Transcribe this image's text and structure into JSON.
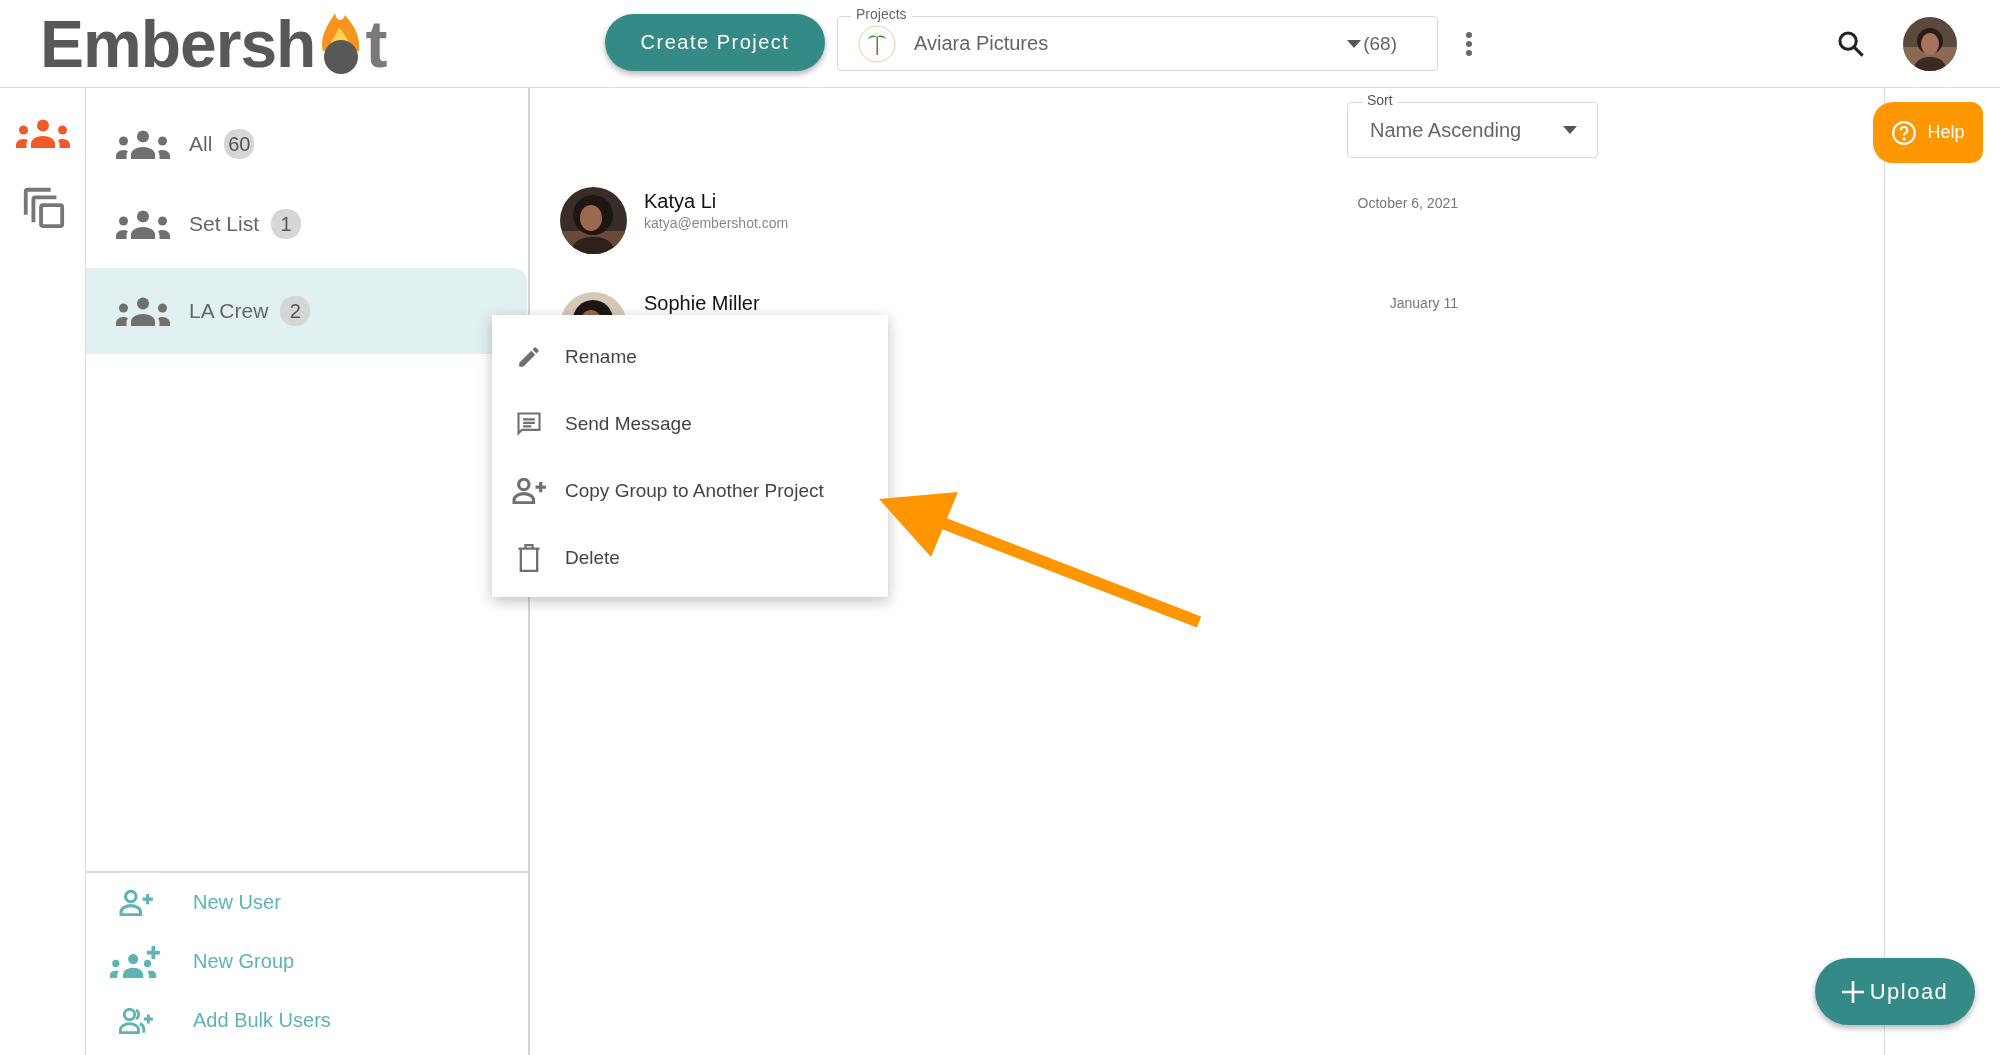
{
  "header": {
    "logo": {
      "before": "Embersh",
      "after": "t"
    },
    "create_button": "Create Project",
    "project_field": {
      "label": "Projects",
      "value": "Aviara Pictures",
      "count": "(68)"
    }
  },
  "rail": [
    {
      "kind": "groups",
      "selected": true
    },
    {
      "kind": "copy",
      "selected": false
    }
  ],
  "groups": [
    {
      "name": "All",
      "count": "60",
      "selected": false
    },
    {
      "name": "Set List",
      "count": "1",
      "selected": false
    },
    {
      "name": "LA Crew",
      "count": "2",
      "selected": true
    }
  ],
  "group_actions": [
    {
      "kind": "user",
      "label": "New User"
    },
    {
      "kind": "group",
      "label": "New Group"
    },
    {
      "kind": "bulk",
      "label": "Add Bulk Users"
    }
  ],
  "sort": {
    "label": "Sort",
    "value": "Name Ascending"
  },
  "help_button": "Help",
  "users": [
    {
      "name": "Katya Li",
      "email": "katya@embershot.com",
      "date": "October 6, 2021"
    },
    {
      "name": "Sophie Miller",
      "date": "January 11"
    }
  ],
  "context_menu": [
    {
      "kind": "rename",
      "label": "Rename"
    },
    {
      "kind": "message",
      "label": "Send Message"
    },
    {
      "kind": "copy",
      "label": "Copy Group to Another Project"
    },
    {
      "kind": "delete",
      "label": "Delete"
    }
  ],
  "upload_button": "Upload"
}
